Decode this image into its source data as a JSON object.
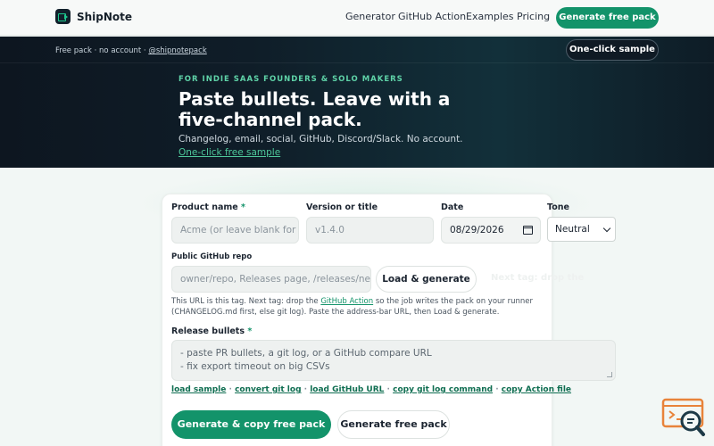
{
  "brand": {
    "name": "ShipNote"
  },
  "nav": {
    "links": [
      "Generator",
      "GitHub Action",
      "Examples",
      "Pricing"
    ],
    "cta": "Generate free pack"
  },
  "hero": {
    "pack_note": "Free pack · no account ·",
    "handle": "@shipnotepack",
    "sample_button": "One-click sample",
    "eyebrow": "FOR INDIE SAAS FOUNDERS & SOLO MAKERS",
    "headline": "Paste bullets. Leave with a five-channel pack.",
    "subline": "Changelog, email, social, GitHub, Discord/Slack. No account.",
    "free_link": "One-click free sample"
  },
  "form": {
    "product_name": {
      "label": "Product name",
      "required": "*",
      "placeholder": "Acme (or leave blank for"
    },
    "version": {
      "label": "Version or title",
      "placeholder": "v1.4.0"
    },
    "date": {
      "label": "Date",
      "value": "08/29/2026"
    },
    "tone": {
      "label": "Tone",
      "value": "Neutral"
    },
    "repo": {
      "label": "Public GitHub repo",
      "placeholder": "owner/repo, Releases page, /releases/new",
      "load_button": "Load & generate",
      "faint_hint": "Next tag: drop the",
      "help_pre": "This URL is this tag. Next tag: drop the ",
      "help_link": "GitHub Action",
      "help_post": " so the job writes the pack on your runner (CHANGELOG.md first, else git log). Paste the address-bar URL, then Load & generate."
    },
    "bullets": {
      "label": "Release bullets",
      "required": "*",
      "line1": "- paste PR bullets, a git log, or a GitHub compare URL",
      "line2": "- fix export timeout on big CSVs"
    },
    "quick_links": [
      "load sample",
      "convert git log",
      "load GitHub URL",
      "copy git log command",
      "copy Action file"
    ],
    "separator": "·",
    "primary_button": "Generate & copy free pack",
    "secondary_button": "Generate free pack"
  },
  "colors": {
    "accent": "#13936a",
    "hero_bg": "#0f1d28",
    "eyebrow": "#5fd3a8"
  }
}
